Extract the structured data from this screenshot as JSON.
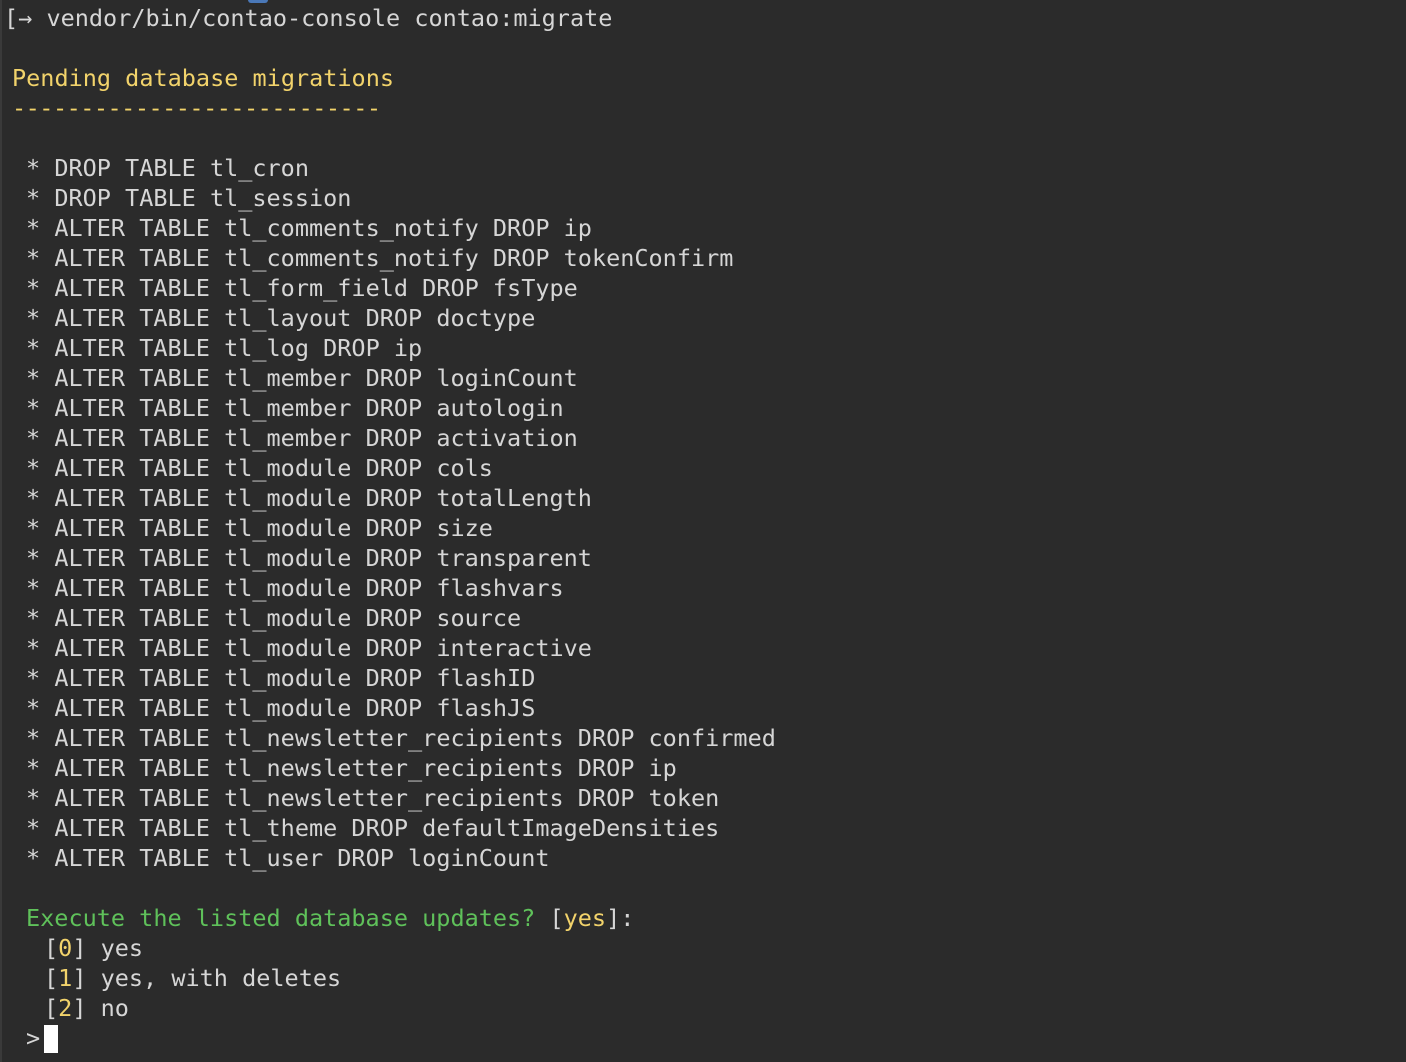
{
  "command": {
    "bracket": "[",
    "arrow": "→",
    "text": "vendor/bin/contao-console contao:migrate"
  },
  "section": {
    "title": "Pending database migrations",
    "rule": "---------------------------"
  },
  "bullet": "*",
  "migrations": [
    "DROP TABLE tl_cron",
    "DROP TABLE tl_session",
    "ALTER TABLE tl_comments_notify DROP ip",
    "ALTER TABLE tl_comments_notify DROP tokenConfirm",
    "ALTER TABLE tl_form_field DROP fsType",
    "ALTER TABLE tl_layout DROP doctype",
    "ALTER TABLE tl_log DROP ip",
    "ALTER TABLE tl_member DROP loginCount",
    "ALTER TABLE tl_member DROP autologin",
    "ALTER TABLE tl_member DROP activation",
    "ALTER TABLE tl_module DROP cols",
    "ALTER TABLE tl_module DROP totalLength",
    "ALTER TABLE tl_module DROP size",
    "ALTER TABLE tl_module DROP transparent",
    "ALTER TABLE tl_module DROP flashvars",
    "ALTER TABLE tl_module DROP source",
    "ALTER TABLE tl_module DROP interactive",
    "ALTER TABLE tl_module DROP flashID",
    "ALTER TABLE tl_module DROP flashJS",
    "ALTER TABLE tl_newsletter_recipients DROP confirmed",
    "ALTER TABLE tl_newsletter_recipients DROP ip",
    "ALTER TABLE tl_newsletter_recipients DROP token",
    "ALTER TABLE tl_theme DROP defaultImageDensities",
    "ALTER TABLE tl_user DROP loginCount"
  ],
  "question": {
    "text": "Execute the listed database updates?",
    "default_open": " [",
    "default_value": "yes",
    "default_close": "]:"
  },
  "choices": [
    {
      "open": "[",
      "index": "0",
      "close": "]",
      "label": " yes"
    },
    {
      "open": "[",
      "index": "1",
      "close": "]",
      "label": " yes, with deletes"
    },
    {
      "open": "[",
      "index": "2",
      "close": "]",
      "label": " no"
    }
  ],
  "prompt_symbol": ">",
  "colors": {
    "background": "#2b2b2b",
    "text": "#d6d6d6",
    "heading": "#f2d36b",
    "question": "#5fc15a",
    "cursor": "#ffffff"
  }
}
